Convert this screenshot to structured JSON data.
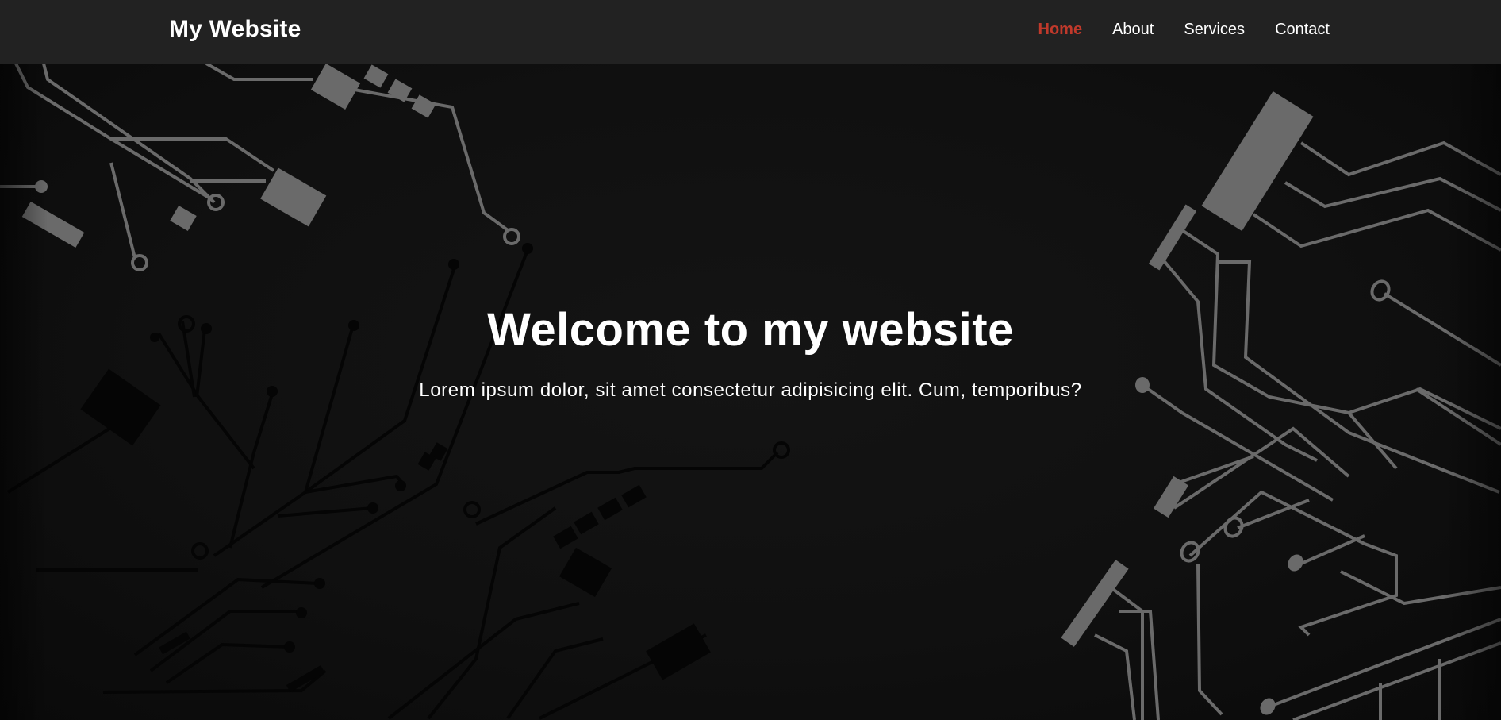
{
  "navbar": {
    "brand": "My Website",
    "links": [
      {
        "label": "Home",
        "active": true
      },
      {
        "label": "About",
        "active": false
      },
      {
        "label": "Services",
        "active": false
      },
      {
        "label": "Contact",
        "active": false
      }
    ]
  },
  "hero": {
    "title": "Welcome to my website",
    "subtitle": "Lorem ipsum dolor, sit amet consectetur adipisicing elit. Cum, temporibus?",
    "background": "circuit-board-pattern"
  },
  "colors": {
    "navbar_bg": "#222222",
    "accent_active": "#c0392b",
    "text": "#ffffff",
    "circuit_light": "#6a6a6a",
    "circuit_dark": "#050505"
  }
}
